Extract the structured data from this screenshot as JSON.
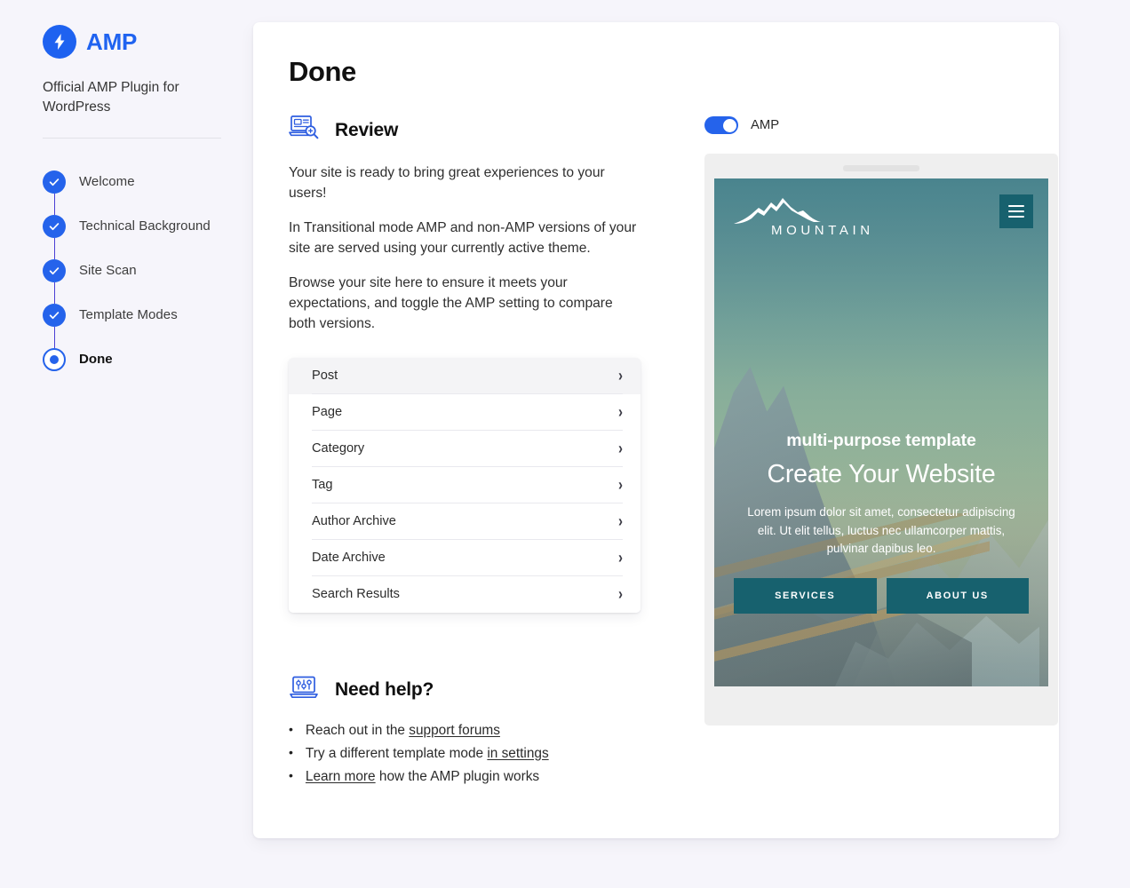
{
  "sidebar": {
    "brand_name": "AMP",
    "brand_icon": "lightning-bolt-icon",
    "tagline": "Official AMP Plugin for WordPress",
    "steps": [
      {
        "label": "Welcome",
        "state": "complete"
      },
      {
        "label": "Technical Background",
        "state": "complete"
      },
      {
        "label": "Site Scan",
        "state": "complete"
      },
      {
        "label": "Template Modes",
        "state": "complete"
      },
      {
        "label": "Done",
        "state": "current"
      }
    ]
  },
  "main": {
    "page_title": "Done",
    "review": {
      "icon": "laptop-search-icon",
      "title": "Review",
      "paragraphs": [
        "Your site is ready to bring great experiences to your users!",
        "In Transitional mode AMP and non-AMP versions of your site are served using your currently active theme.",
        "Browse your site here to ensure it meets your expectations, and toggle the AMP setting to compare both versions."
      ],
      "links": [
        {
          "label": "Post",
          "highlighted": true
        },
        {
          "label": "Page",
          "highlighted": false
        },
        {
          "label": "Category",
          "highlighted": false
        },
        {
          "label": "Tag",
          "highlighted": false
        },
        {
          "label": "Author Archive",
          "highlighted": false
        },
        {
          "label": "Date Archive",
          "highlighted": false
        },
        {
          "label": "Search Results",
          "highlighted": false
        }
      ],
      "chevron": "›"
    },
    "help": {
      "icon": "laptop-settings-icon",
      "title": "Need help?",
      "bullet": "•",
      "items": [
        {
          "prefix": "Reach out in the ",
          "link": "support forums",
          "suffix": ""
        },
        {
          "prefix": "Try a different template mode ",
          "link": "in settings",
          "suffix": ""
        },
        {
          "prefix": "",
          "link": "Learn more",
          "suffix": " how the AMP plugin works"
        }
      ]
    }
  },
  "preview": {
    "toggle_label": "AMP",
    "toggle_on": true,
    "site": {
      "logo_text": "MOUNTAIN",
      "logo_icon": "mountain-range-icon",
      "menu_icon": "hamburger-menu-icon",
      "eyebrow": "multi-purpose template",
      "title": "Create Your Website",
      "subtitle": "Lorem ipsum dolor sit amet, consectetur adipiscing elit. Ut elit tellus, luctus nec ullamcorper mattis, pulvinar dapibus leo.",
      "buttons": [
        "SERVICES",
        "ABOUT US"
      ]
    }
  },
  "colors": {
    "amp_blue": "#2563eb",
    "brand_blue": "#2063f0",
    "page_bg": "#f6f5fb",
    "card_bg": "#ffffff",
    "teal": "#17616e",
    "step_line": "#4b3fd4"
  }
}
